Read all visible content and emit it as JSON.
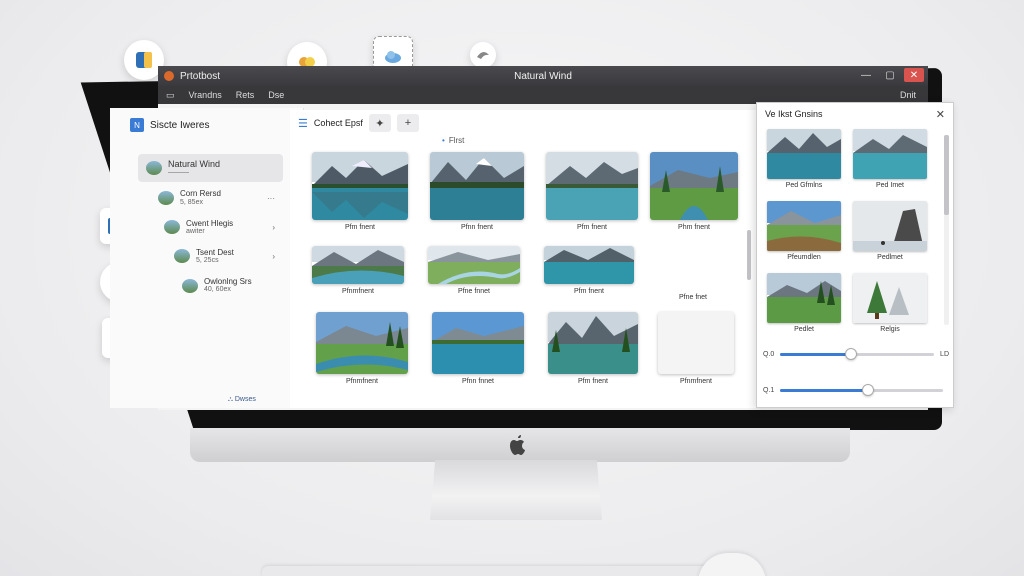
{
  "window": {
    "app_title": "Prtotbost",
    "doc_title": "Natural Wind",
    "min": "—",
    "max": "▢",
    "close": "✕"
  },
  "menu": {
    "items": [
      "Vrandns",
      "Rets",
      "Dse"
    ],
    "right": "Dnit"
  },
  "sidebar": {
    "header": "Siscte Iweres",
    "badge": "N",
    "items": [
      {
        "label": "Natural Wind",
        "sub": ""
      },
      {
        "label": "Corn Rersd",
        "sub": "5, 85ex"
      },
      {
        "label": "Cwent Hlegis",
        "sub": "awiter"
      },
      {
        "label": "Tsent Dest",
        "sub": "5, 25cs"
      },
      {
        "label": "Owlonlng Srs",
        "sub": "40, 60ex"
      }
    ],
    "footer": "Dwses"
  },
  "toolbar": {
    "label": "Cohect Epsf",
    "btn1": "✦",
    "btn2": "+",
    "filter": "Flrst"
  },
  "photos": {
    "row1": [
      "Pfm fnent",
      "Pfnn fnent",
      "Pfm fnent",
      "Phm fnent"
    ],
    "row2": [
      "Pfnmfnent",
      "Pfne fnnet",
      "Pfm fnent",
      "Pfne fnet"
    ],
    "row3": [
      "Pfnmfnent",
      "Pfnn fnnet",
      "Pfm fnent",
      "Pfnmfnent"
    ]
  },
  "panel": {
    "title": "Ve Ikst Gnsins",
    "close": "✕",
    "thumbs": [
      "Ped Gfmlns",
      "Ped Imet",
      "Pfeumdlen",
      "Pedlmet",
      "Pedlet",
      "Relgis"
    ],
    "slider1": {
      "left": "Q.0",
      "right": "LD",
      "value": 0.46
    },
    "slider2": {
      "left": "Q.1",
      "value": 0.54
    }
  },
  "colors": {
    "accent": "#3a7bd5",
    "titlebar": "#3a3a3e",
    "close": "#d9534f"
  }
}
